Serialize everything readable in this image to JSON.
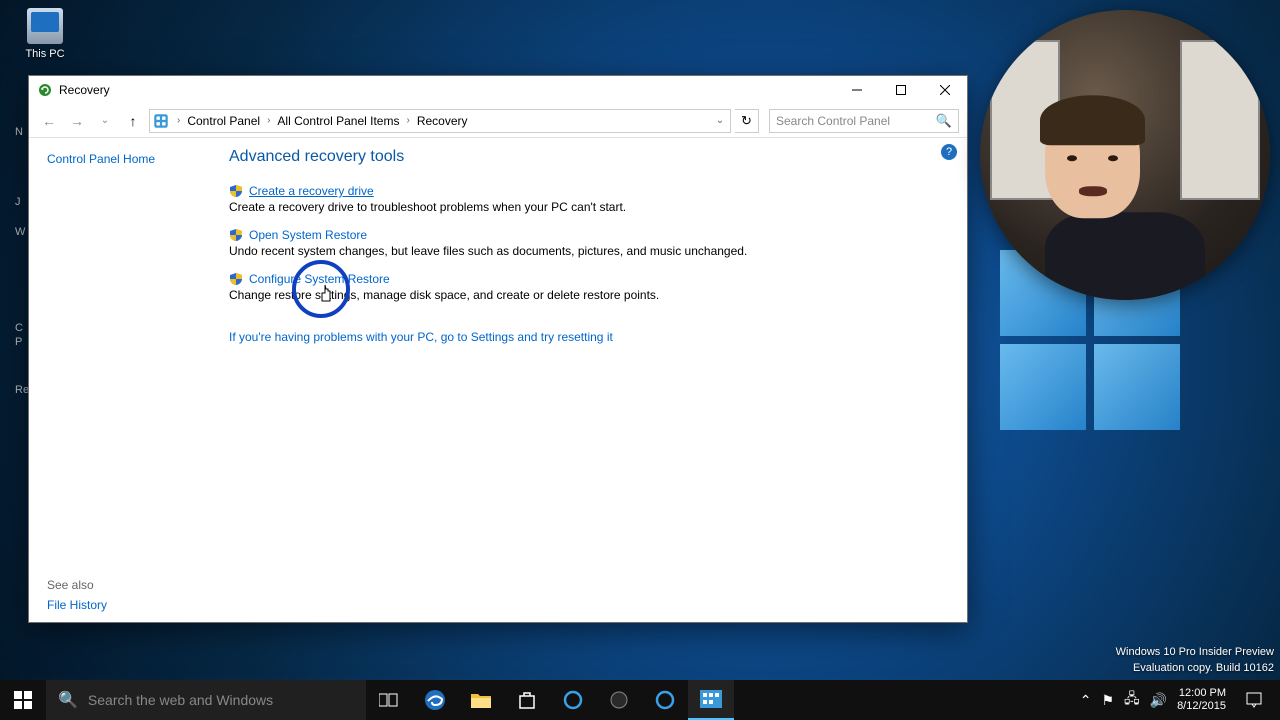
{
  "desktop": {
    "icons": {
      "this_pc": "This PC",
      "partial_labels": [
        "N",
        "J",
        "W",
        "C",
        "P",
        "Rec"
      ]
    }
  },
  "window": {
    "title": "Recovery",
    "breadcrumb": [
      "Control Panel",
      "All Control Panel Items",
      "Recovery"
    ],
    "search_placeholder": "Search Control Panel",
    "sidebar": {
      "home": "Control Panel Home",
      "see_also": "See also",
      "file_history": "File History"
    },
    "content": {
      "heading": "Advanced recovery tools",
      "tools": [
        {
          "link": "Create a recovery drive",
          "desc": "Create a recovery drive to troubleshoot problems when your PC can't start."
        },
        {
          "link": "Open System Restore",
          "desc": "Undo recent system changes, but leave files such as documents, pictures, and music unchanged."
        },
        {
          "link": "Configure System Restore",
          "desc": "Change restore settings, manage disk space, and create or delete restore points."
        }
      ],
      "troubleshoot_link": "If you're having problems with your PC, go to Settings and try resetting it"
    }
  },
  "taskbar": {
    "search_placeholder": "Search the web and Windows"
  },
  "watermark": {
    "line1": "Windows 10 Pro Insider Preview",
    "line2": "Evaluation copy. Build 10162"
  },
  "clock": {
    "time": "12:00 PM",
    "date": "8/12/2015"
  }
}
